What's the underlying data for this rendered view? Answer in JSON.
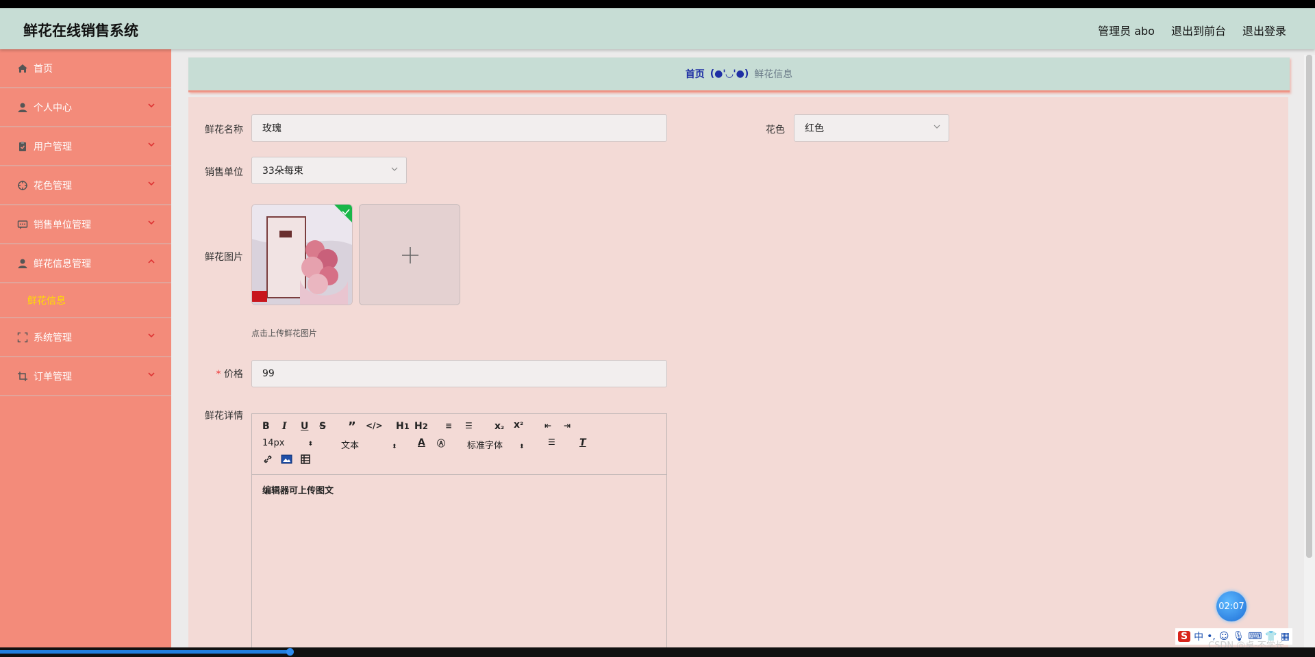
{
  "app": {
    "title": "鲜花在线销售系统"
  },
  "header": {
    "admin": "管理员 abo",
    "to_front": "退出到前台",
    "logout": "退出登录"
  },
  "sidebar": {
    "items": [
      {
        "label": "首页"
      },
      {
        "label": "个人中心"
      },
      {
        "label": "用户管理"
      },
      {
        "label": "花色管理"
      },
      {
        "label": "销售单位管理"
      },
      {
        "label": "鲜花信息管理"
      },
      {
        "label": "系统管理"
      },
      {
        "label": "订单管理"
      }
    ],
    "sub_item": "鲜花信息"
  },
  "breadcrumb": {
    "home": "首页",
    "sep": "(●'◡'●)",
    "current": "鲜花信息"
  },
  "form": {
    "name_label": "鲜花名称",
    "name_value": "玫瑰",
    "color_label": "花色",
    "color_value": "红色",
    "unit_label": "销售单位",
    "unit_value": "33朵每束",
    "image_label": "鲜花图片",
    "image_hint": "点击上传鲜花图片",
    "price_required": "*",
    "price_label": "价格",
    "price_value": "99",
    "detail_label": "鲜花详情"
  },
  "editor": {
    "font_size": "14px",
    "block_type": "文本",
    "font_family": "标准字体",
    "content": "编辑器可上传图文"
  },
  "overlay": {
    "timer": "02:07",
    "ime_logo": "S",
    "ime_lang": "中",
    "watermark": "CSDN @卓-不学长"
  },
  "colors": {
    "header": "#c7ddd5",
    "sidebar": "#f38b7a",
    "content": "#f3dad6",
    "active": "#ffdd00"
  }
}
